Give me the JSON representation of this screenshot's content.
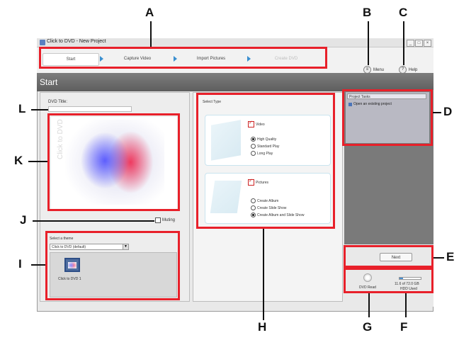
{
  "window": {
    "title": "Click to DVD - New Project",
    "controls": [
      "_",
      "□",
      "×"
    ]
  },
  "steps": [
    {
      "label": "Start",
      "state": "active"
    },
    {
      "label": "Capture Video",
      "state": "normal"
    },
    {
      "label": "Import Pictures",
      "state": "normal"
    },
    {
      "label": "Create DVD",
      "state": "disabled"
    }
  ],
  "toolbar": {
    "menu_label": "Menu",
    "help_label": "Help",
    "menu_icon": "menu-icon",
    "help_icon": "help-icon"
  },
  "header": {
    "title": "Start"
  },
  "left": {
    "dvd_title_label": "DVD Title:",
    "dvd_title_value": "",
    "thumb_text": "Click to DVD",
    "muting_label": "Muting",
    "theme_label": "Select a theme",
    "theme_value": "Click to DVD (default)",
    "theme_item": "Click to DVD 1"
  },
  "center": {
    "select_type": "Select Type",
    "video_label": "Video",
    "video_options": [
      "High Quality",
      "Standard Play",
      "Long Play"
    ],
    "video_selected": 0,
    "pictures_label": "Pictures",
    "picture_options": [
      "Create Album",
      "Create Slide Show",
      "Create Album and Slide Show"
    ],
    "picture_selected": 2
  },
  "right": {
    "project_tasks": "Project Tasks",
    "open_project": "Open an existing project",
    "next_label": "Next",
    "dvd_read_label": "DVD Read",
    "capacity_text": "11.6 of 72.0 GB",
    "hdd_label": "HDD Used"
  },
  "annotations": [
    "A",
    "B",
    "C",
    "D",
    "E",
    "F",
    "G",
    "H",
    "I",
    "J",
    "K",
    "L"
  ],
  "colors": {
    "annotation_red": "#e8202a",
    "arrow_blue": "#3a8fd0",
    "header_gray": "#6e6e6e"
  }
}
